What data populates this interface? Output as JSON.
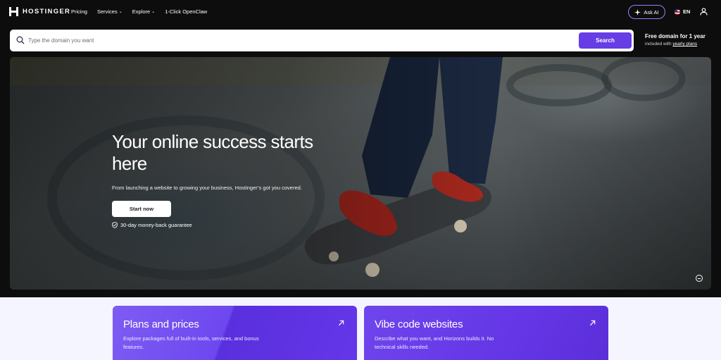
{
  "brand": {
    "name": "HOSTINGER"
  },
  "nav": {
    "links": [
      {
        "label": "Pricing",
        "has_chevron": false
      },
      {
        "label": "Services",
        "has_chevron": true
      },
      {
        "label": "Explore",
        "has_chevron": true
      },
      {
        "label": "1-Click OpenClaw",
        "has_chevron": false
      }
    ],
    "ask_ai": "Ask AI",
    "language": "EN",
    "icons": {
      "ask_ai": "sparkle-icon",
      "language": "us-flag-icon",
      "account": "user-icon"
    }
  },
  "domain_search": {
    "placeholder": "Type the domain you want",
    "value": "",
    "button": "Search",
    "promo_title": "Free domain for 1 year",
    "promo_prefix": "included with",
    "promo_link": "yearly plans"
  },
  "hero": {
    "title": "Your online success starts here",
    "subtitle": "From launching a website to growing your business, Hostinger’s got you covered.",
    "cta": "Start now",
    "guarantee": "30-day money-back guarantee",
    "icons": {
      "guarantee": "shield-check-icon",
      "video": "pause-icon"
    }
  },
  "cards": [
    {
      "title": "Plans and prices",
      "description": "Explore packages full of built-in tools, services, and bonus features."
    },
    {
      "title": "Vibe code websites",
      "description": "Describe what you want, and Horizons builds it. No technical skills needed."
    }
  ],
  "colors": {
    "accent": "#673de6",
    "page_bg": "#0d0d0d",
    "lower_bg": "#f4f5ff",
    "ask_ai_border": "#8c85ff"
  }
}
